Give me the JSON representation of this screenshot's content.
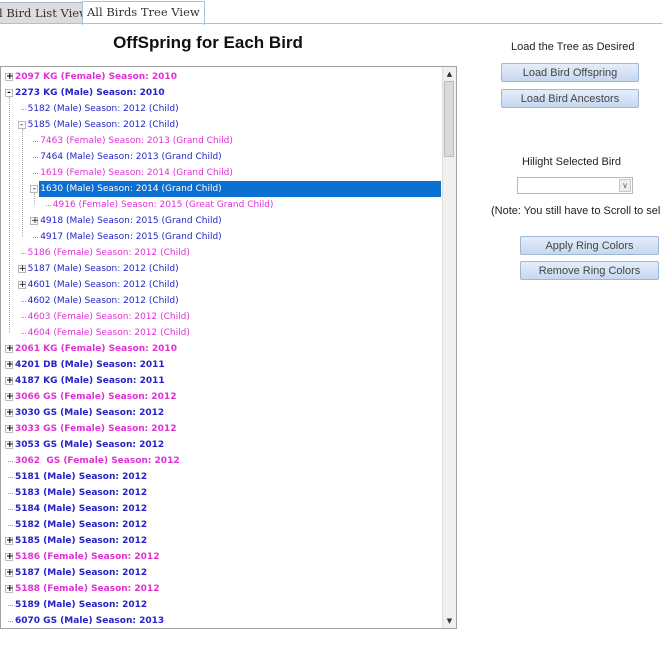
{
  "tabs": [
    {
      "label": "All Bird List View",
      "visible": "l Bird List View"
    },
    {
      "label": "All Birds Tree View"
    }
  ],
  "title": "OffSpring for Each Bird",
  "side": {
    "load_label": "Load the Tree as Desired",
    "load_offspring": "Load Bird Offspring",
    "load_ancestors": "Load Bird Ancestors",
    "hilight_label": "Hilight Selected Bird",
    "hilight_value": "",
    "note": "(Note: You still have to Scroll to sel",
    "apply_ring": "Apply Ring Colors",
    "remove_ring": "Remove Ring Colors"
  },
  "colors": {
    "male": "#2323c8",
    "female": "#e030d8",
    "selected": "#0a6fd1"
  },
  "tree": [
    {
      "level": 0,
      "exp": "+",
      "sex": "female",
      "text": "2097 KG (Female) Season: 2010"
    },
    {
      "level": 0,
      "exp": "-",
      "sex": "male",
      "text": "2273 KG (Male) Season: 2010"
    },
    {
      "level": 1,
      "exp": "",
      "sex": "male",
      "text": "5182 (Male) Season: 2012 (Child)"
    },
    {
      "level": 1,
      "exp": "-",
      "sex": "male",
      "text": "5185 (Male) Season: 2012 (Child)"
    },
    {
      "level": 2,
      "exp": "",
      "sex": "female",
      "text": "7463 (Female) Season: 2013 (Grand Child)"
    },
    {
      "level": 2,
      "exp": "",
      "sex": "male",
      "text": "7464 (Male) Season: 2013 (Grand Child)"
    },
    {
      "level": 2,
      "exp": "",
      "sex": "female",
      "text": "1619 (Female) Season: 2014 (Grand Child)"
    },
    {
      "level": 2,
      "exp": "-",
      "sex": "male",
      "text": "1630 (Male) Season: 2014 (Grand Child)",
      "selected": true
    },
    {
      "level": 3,
      "exp": "",
      "sex": "female",
      "text": "4916 (Female) Season: 2015 (Great Grand Child)"
    },
    {
      "level": 2,
      "exp": "+",
      "sex": "male",
      "text": "4918 (Male) Season: 2015 (Grand Child)"
    },
    {
      "level": 2,
      "exp": "",
      "sex": "male",
      "text": "4917 (Male) Season: 2015 (Grand Child)"
    },
    {
      "level": 1,
      "exp": "",
      "sex": "female",
      "text": "5186 (Female) Season: 2012 (Child)"
    },
    {
      "level": 1,
      "exp": "+",
      "sex": "male",
      "text": "5187 (Male) Season: 2012 (Child)"
    },
    {
      "level": 1,
      "exp": "+",
      "sex": "male",
      "text": "4601 (Male) Season: 2012 (Child)"
    },
    {
      "level": 1,
      "exp": "",
      "sex": "male",
      "text": "4602 (Male) Season: 2012 (Child)"
    },
    {
      "level": 1,
      "exp": "",
      "sex": "female",
      "text": "4603 (Female) Season: 2012 (Child)"
    },
    {
      "level": 1,
      "exp": "",
      "sex": "female",
      "text": "4604 (Female) Season: 2012 (Child)"
    },
    {
      "level": 0,
      "exp": "+",
      "sex": "female",
      "text": "2061 KG (Female) Season: 2010"
    },
    {
      "level": 0,
      "exp": "+",
      "sex": "male",
      "text": "4201 DB (Male) Season: 2011"
    },
    {
      "level": 0,
      "exp": "+",
      "sex": "male",
      "text": "4187 KG (Male) Season: 2011"
    },
    {
      "level": 0,
      "exp": "+",
      "sex": "female",
      "text": "3066 GS (Female) Season: 2012"
    },
    {
      "level": 0,
      "exp": "+",
      "sex": "male",
      "text": "3030 GS (Male) Season: 2012"
    },
    {
      "level": 0,
      "exp": "+",
      "sex": "female",
      "text": "3033 GS (Female) Season: 2012"
    },
    {
      "level": 0,
      "exp": "+",
      "sex": "male",
      "text": "3053 GS (Male) Season: 2012"
    },
    {
      "level": 0,
      "exp": "",
      "sex": "female",
      "text": "3062  GS (Female) Season: 2012"
    },
    {
      "level": 0,
      "exp": "",
      "sex": "male",
      "text": "5181 (Male) Season: 2012"
    },
    {
      "level": 0,
      "exp": "",
      "sex": "male",
      "text": "5183 (Male) Season: 2012"
    },
    {
      "level": 0,
      "exp": "",
      "sex": "male",
      "text": "5184 (Male) Season: 2012"
    },
    {
      "level": 0,
      "exp": "",
      "sex": "male",
      "text": "5182 (Male) Season: 2012"
    },
    {
      "level": 0,
      "exp": "+",
      "sex": "male",
      "text": "5185 (Male) Season: 2012"
    },
    {
      "level": 0,
      "exp": "+",
      "sex": "female",
      "text": "5186 (Female) Season: 2012"
    },
    {
      "level": 0,
      "exp": "+",
      "sex": "male",
      "text": "5187 (Male) Season: 2012"
    },
    {
      "level": 0,
      "exp": "+",
      "sex": "female",
      "text": "5188 (Female) Season: 2012"
    },
    {
      "level": 0,
      "exp": "",
      "sex": "male",
      "text": "5189 (Male) Season: 2012"
    },
    {
      "level": 0,
      "exp": "",
      "sex": "male",
      "text": "6070 GS (Male) Season: 2013"
    }
  ]
}
